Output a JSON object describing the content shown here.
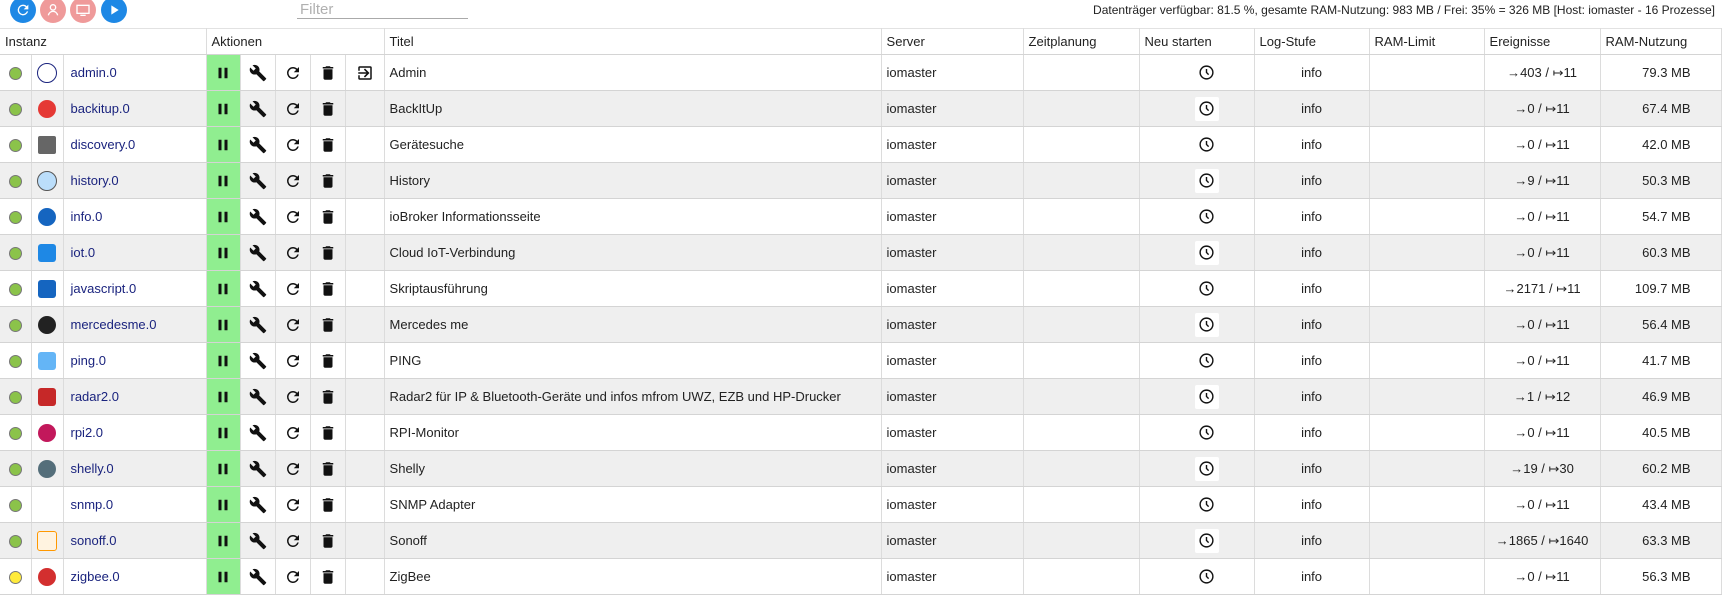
{
  "toolbar": {
    "filter_placeholder": "Filter",
    "status": "Datenträger verfügbar: 81.5 %, gesamte RAM-Nutzung: 983 MB / Frei: 35% = 326 MB [Host: iomaster - 16 Prozesse]",
    "colors": {
      "blue": "#1e88e5",
      "pink": "#ef9a9a"
    }
  },
  "columns": {
    "instanz": "Instanz",
    "aktionen": "Aktionen",
    "titel": "Titel",
    "server": "Server",
    "zeitplanung": "Zeitplanung",
    "neustarten": "Neu starten",
    "logstufe": "Log-Stufe",
    "ramlimit": "RAM-Limit",
    "ereignisse": "Ereignisse",
    "ramnutzung": "RAM-Nutzung"
  },
  "rows": [
    {
      "status": "green",
      "icon": "admin-logo-icon",
      "instance": "admin.0",
      "title": "Admin",
      "server": "iomaster",
      "log": "info",
      "events": "→403 / ↦11",
      "ram": "79.3 MB",
      "has_open": true
    },
    {
      "status": "green",
      "icon": "backitup-logo-icon",
      "instance": "backitup.0",
      "title": "BackItUp",
      "server": "iomaster",
      "log": "info",
      "events": "→0 / ↦11",
      "ram": "67.4 MB"
    },
    {
      "status": "green",
      "icon": "discovery-logo-icon",
      "instance": "discovery.0",
      "title": "Gerätesuche",
      "server": "iomaster",
      "log": "info",
      "events": "→0 / ↦11",
      "ram": "42.0 MB"
    },
    {
      "status": "green",
      "icon": "history-logo-icon",
      "instance": "history.0",
      "title": "History",
      "server": "iomaster",
      "log": "info",
      "events": "→9 / ↦11",
      "ram": "50.3 MB"
    },
    {
      "status": "green",
      "icon": "info-logo-icon",
      "instance": "info.0",
      "title": "ioBroker Informationsseite",
      "server": "iomaster",
      "log": "info",
      "events": "→0 / ↦11",
      "ram": "54.7 MB"
    },
    {
      "status": "green",
      "icon": "iot-cloud-logo-icon",
      "instance": "iot.0",
      "title": "Cloud IoT-Verbindung",
      "server": "iomaster",
      "log": "info",
      "events": "→0 / ↦11",
      "ram": "60.3 MB"
    },
    {
      "status": "green",
      "icon": "javascript-logo-icon",
      "instance": "javascript.0",
      "title": "Skriptausführung",
      "server": "iomaster",
      "log": "info",
      "events": "→2171 / ↦11",
      "ram": "109.7 MB"
    },
    {
      "status": "green",
      "icon": "mercedes-logo-icon",
      "instance": "mercedesme.0",
      "title": "Mercedes me",
      "server": "iomaster",
      "log": "info",
      "events": "→0 / ↦11",
      "ram": "56.4 MB"
    },
    {
      "status": "green",
      "icon": "ping-logo-icon",
      "instance": "ping.0",
      "title": "PING",
      "server": "iomaster",
      "log": "info",
      "events": "→0 / ↦11",
      "ram": "41.7 MB"
    },
    {
      "status": "green",
      "icon": "radar-logo-icon",
      "instance": "radar2.0",
      "title": "Radar2 für IP & Bluetooth-Geräte und infos mfrom UWZ, EZB und HP-Drucker",
      "server": "iomaster",
      "log": "info",
      "events": "→1 / ↦12",
      "ram": "46.9 MB"
    },
    {
      "status": "green",
      "icon": "raspberry-logo-icon",
      "instance": "rpi2.0",
      "title": "RPI-Monitor",
      "server": "iomaster",
      "log": "info",
      "events": "→0 / ↦11",
      "ram": "40.5 MB"
    },
    {
      "status": "green",
      "icon": "shelly-logo-icon",
      "instance": "shelly.0",
      "title": "Shelly",
      "server": "iomaster",
      "log": "info",
      "events": "→19 / ↦30",
      "ram": "60.2 MB"
    },
    {
      "status": "green",
      "icon": "snmp-logo-icon",
      "instance": "snmp.0",
      "title": "SNMP Adapter",
      "server": "iomaster",
      "log": "info",
      "events": "→0 / ↦11",
      "ram": "43.4 MB"
    },
    {
      "status": "green",
      "icon": "sonoff-logo-icon",
      "instance": "sonoff.0",
      "title": "Sonoff",
      "server": "iomaster",
      "log": "info",
      "events": "→1865 / ↦1640",
      "ram": "63.3 MB"
    },
    {
      "status": "yellow",
      "icon": "zigbee-logo-icon",
      "instance": "zigbee.0",
      "title": "ZigBee",
      "server": "iomaster",
      "log": "info",
      "events": "→0 / ↦11",
      "ram": "56.3 MB"
    }
  ]
}
